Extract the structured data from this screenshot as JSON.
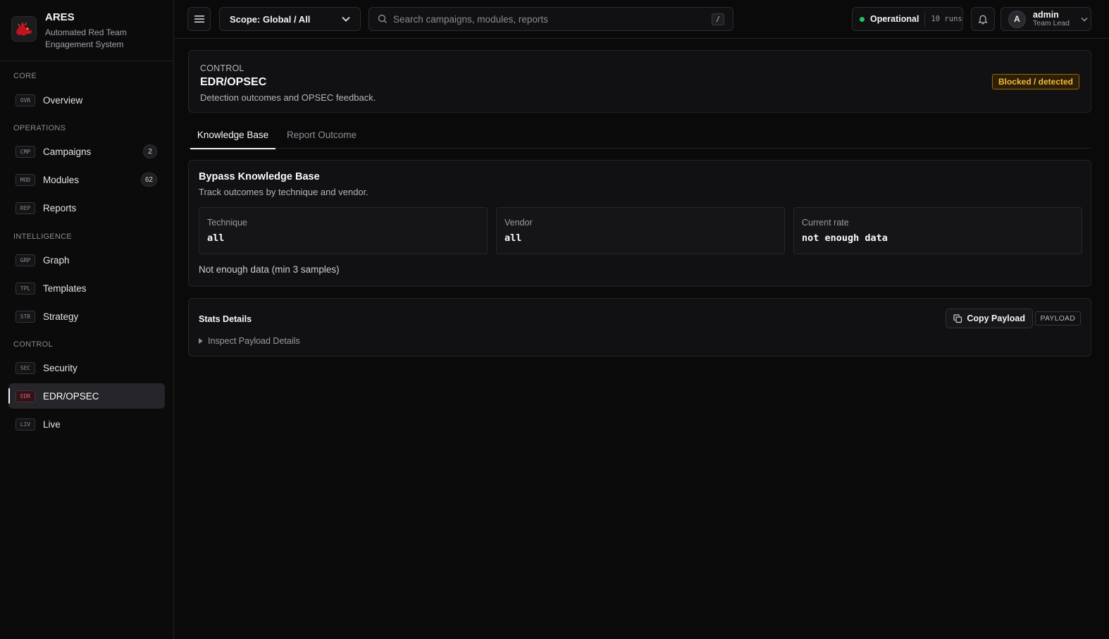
{
  "brand": {
    "name": "ARES",
    "subtitle": "Automated Red Team Engagement System"
  },
  "sidebar": {
    "sections": [
      {
        "label": "CORE"
      },
      {
        "label": "OPERATIONS"
      },
      {
        "label": "INTELLIGENCE"
      },
      {
        "label": "CONTROL"
      }
    ],
    "items": [
      {
        "code": "OVR",
        "label": "Overview"
      },
      {
        "code": "CMP",
        "label": "Campaigns",
        "badge": "2"
      },
      {
        "code": "MOD",
        "label": "Modules",
        "badge": "62"
      },
      {
        "code": "REP",
        "label": "Reports"
      },
      {
        "code": "GRP",
        "label": "Graph"
      },
      {
        "code": "TPL",
        "label": "Templates"
      },
      {
        "code": "STR",
        "label": "Strategy"
      },
      {
        "code": "SEC",
        "label": "Security"
      },
      {
        "code": "EDR",
        "label": "EDR/OPSEC",
        "active": true
      },
      {
        "code": "LIV",
        "label": "Live"
      }
    ]
  },
  "topbar": {
    "scope_label": "Scope: Global / All",
    "search_placeholder": "Search campaigns, modules, reports",
    "search_shortcut": "/",
    "status_label": "Operational",
    "status_runs": "10 runs",
    "user_initial": "A",
    "user_name": "admin",
    "user_role": "Team Lead"
  },
  "header": {
    "eyebrow": "CONTROL",
    "title": "EDR/OPSEC",
    "description": "Detection outcomes and OPSEC feedback.",
    "status_pill": "Blocked / detected"
  },
  "tabs": [
    {
      "label": "Knowledge Base",
      "active": true
    },
    {
      "label": "Report Outcome",
      "active": false
    }
  ],
  "knowledge_base": {
    "title": "Bypass Knowledge Base",
    "subtitle": "Track outcomes by technique and vendor.",
    "metrics": [
      {
        "label": "Technique",
        "value": "all"
      },
      {
        "label": "Vendor",
        "value": "all"
      },
      {
        "label": "Current rate",
        "value": "not enough data"
      }
    ],
    "note": "Not enough data (min 3 samples)"
  },
  "stats": {
    "title": "Stats Details",
    "copy_label": "Copy Payload",
    "tag": "PAYLOAD",
    "details_label": "Inspect Payload Details"
  },
  "colors": {
    "background": "#0a0a0b",
    "panel": "#111113",
    "accent_warning": "#f5b93a",
    "status_ok": "#22c55e",
    "active_code": "#ef5a6f"
  }
}
